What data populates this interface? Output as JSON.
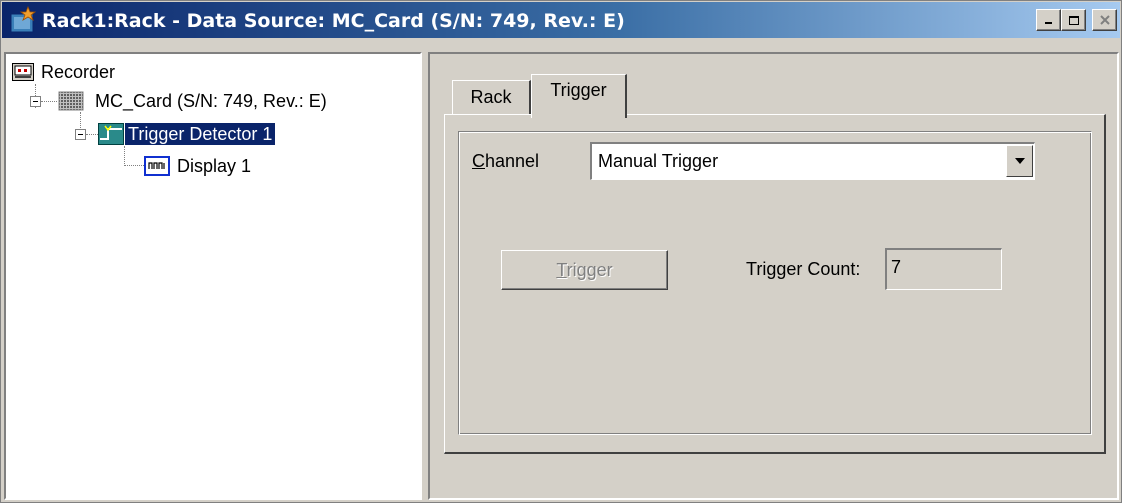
{
  "window": {
    "title": "Rack1:Rack - Data Source: MC_Card (S/N: 749, Rev.: E)",
    "controls": [
      "minimize-icon",
      "maximize-icon",
      "close-icon"
    ]
  },
  "tree": {
    "items": [
      {
        "label": "Recorder",
        "icon": "recorder-icon"
      },
      {
        "label": "MC_Card (S/N: 749, Rev.: E)",
        "icon": "card-icon"
      },
      {
        "label": "Trigger Detector 1",
        "icon": "trigger-detector-icon",
        "selected": true
      },
      {
        "label": "Display 1",
        "icon": "display-icon"
      }
    ]
  },
  "tabs": [
    {
      "label": "Rack",
      "active": false
    },
    {
      "label": "Trigger",
      "active": true
    }
  ],
  "trigger_tab": {
    "channel_label_mnemonic": "C",
    "channel_label_rest": "hannel",
    "channel_value": "Manual Trigger",
    "trigger_button_mnemonic": "T",
    "trigger_button_rest": "rigger",
    "trigger_button_enabled": false,
    "trigger_count_label": "Trigger Count:",
    "trigger_count_value": "7"
  },
  "colors": {
    "face": "#d4d0c8",
    "titlebar_start": "#0a246a",
    "titlebar_end": "#a6caf0",
    "selection": "#0a246a"
  }
}
